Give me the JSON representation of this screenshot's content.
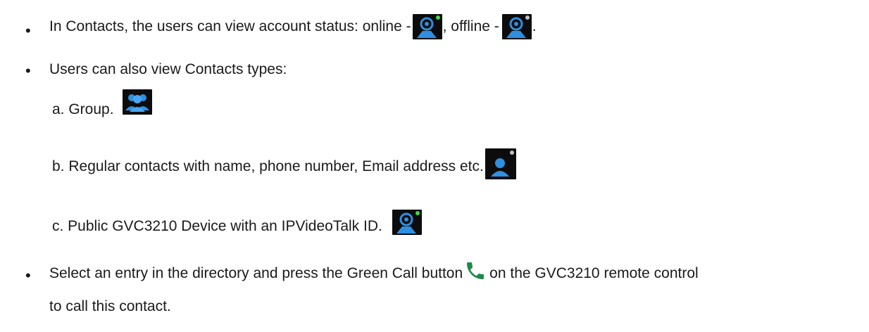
{
  "bullets": {
    "status": {
      "before": "In Contacts, the users can view account status: online - ",
      "middle": ", offline - ",
      "after": "."
    },
    "types_heading": "Users can also view Contacts types:",
    "type_group": "a. Group.",
    "type_regular": "b. Regular contacts with name, phone number, Email address etc.",
    "type_public": "c. Public GVC3210 Device with an IPVideoTalk ID.",
    "call_line1_before": "Select an entry in the directory and press the Green Call button ",
    "call_line1_after": " on the GVC3210 remote control",
    "call_line2": "to call this contact."
  },
  "icons": {
    "online_device": "device-online-icon",
    "offline_device": "device-offline-icon",
    "group": "group-icon",
    "contact": "contact-icon",
    "phone": "phone-icon"
  },
  "colors": {
    "icon_blue": "#2f8fe0",
    "online_dot": "#3ddc4a",
    "offline_dot": "#bfbfbf",
    "call_green": "#1e8a4a",
    "icon_bg": "#0c0c0c"
  }
}
